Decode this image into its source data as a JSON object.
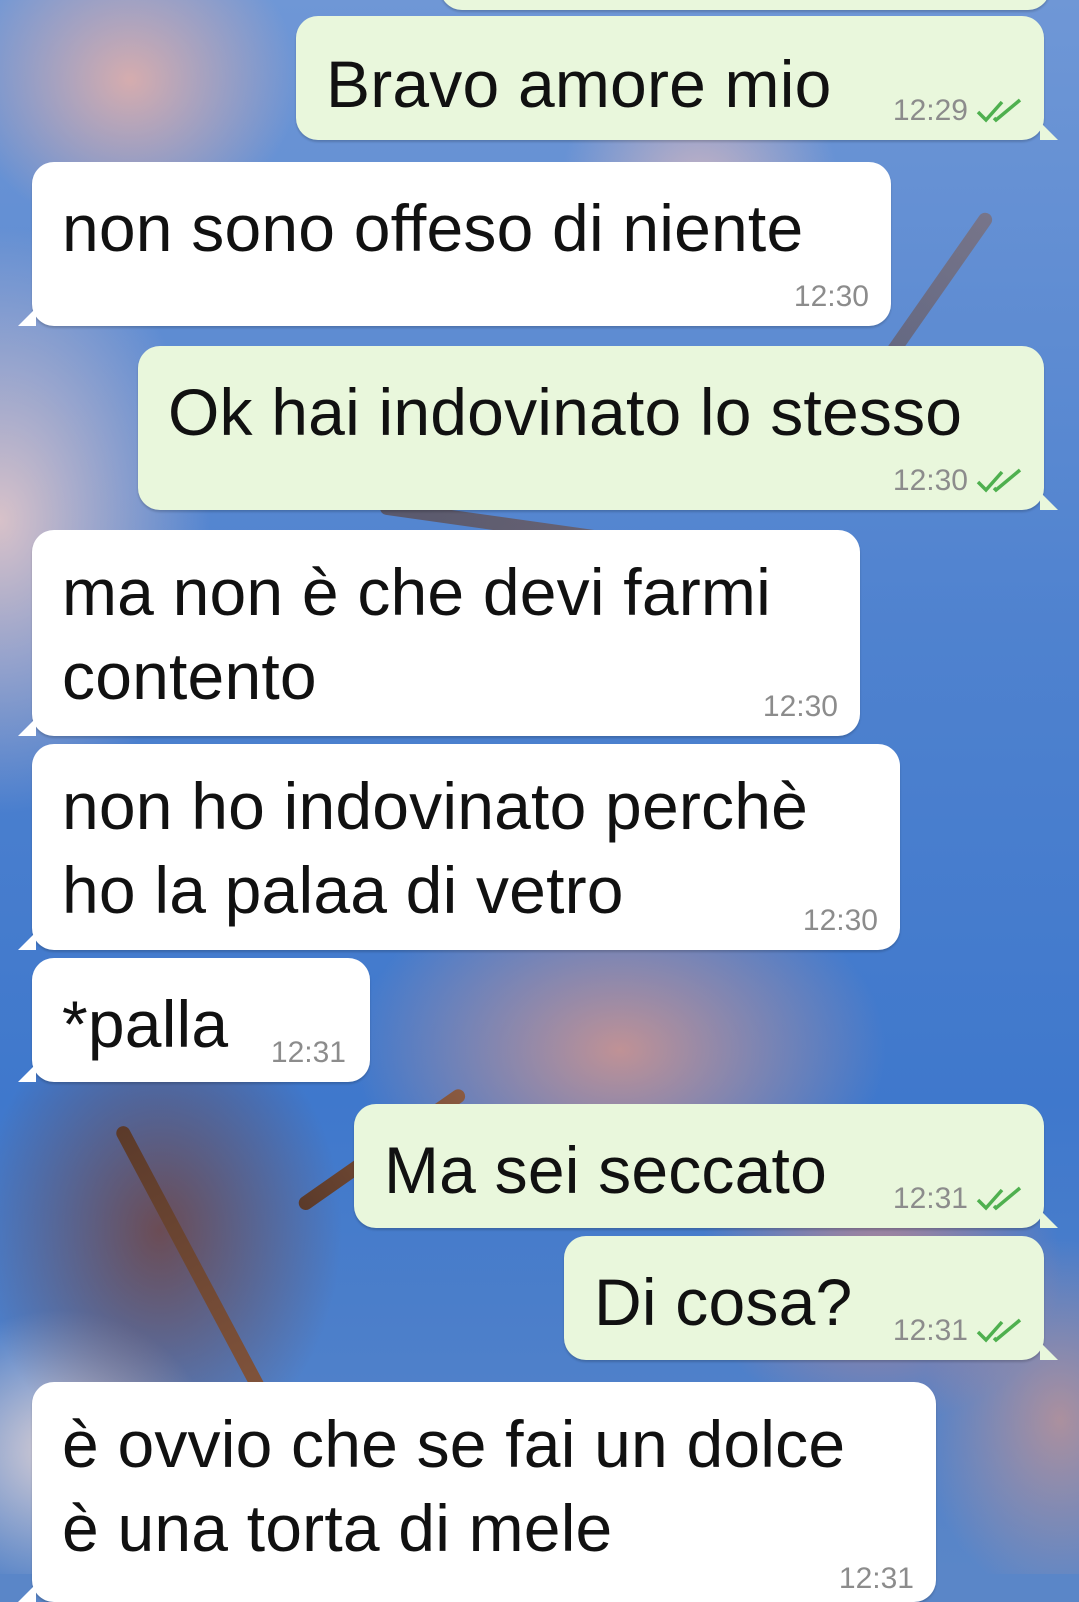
{
  "colors": {
    "incoming_bubble": "#ffffff",
    "outgoing_bubble": "#e9f7dc",
    "timestamp": "#8c8c8c",
    "read_ticks": "#4fb04f"
  },
  "messages": [
    {
      "direction": "out",
      "text": "Bravo amore mio",
      "time": "12:29",
      "ticks_icon": "double-check-icon"
    },
    {
      "direction": "in",
      "text": "non sono offeso di niente",
      "time": "12:30"
    },
    {
      "direction": "out",
      "text": "Ok hai indovinato lo stesso",
      "time": "12:30",
      "ticks_icon": "double-check-icon"
    },
    {
      "direction": "in",
      "text": "ma non è che devi farmi\ncontento",
      "time": "12:30"
    },
    {
      "direction": "in",
      "text": "non ho indovinato perchè\nho la palaa di vetro",
      "time": "12:30"
    },
    {
      "direction": "in",
      "text": "*palla",
      "time": "12:31"
    },
    {
      "direction": "out",
      "text": "Ma sei seccato",
      "time": "12:31",
      "ticks_icon": "double-check-icon"
    },
    {
      "direction": "out",
      "text": "Di cosa?",
      "time": "12:31",
      "ticks_icon": "double-check-icon"
    },
    {
      "direction": "in",
      "text": "è ovvio che se fai un dolce\nè una torta di mele",
      "time": "12:31"
    }
  ]
}
